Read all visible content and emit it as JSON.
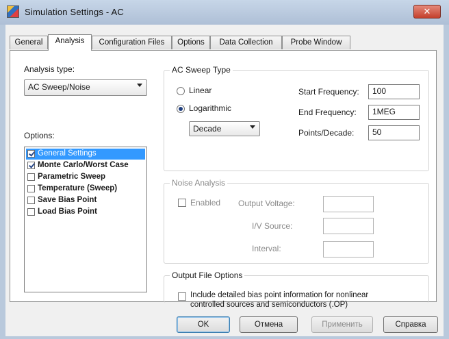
{
  "window": {
    "title": "Simulation Settings - AC",
    "close_glyph": "✕"
  },
  "tabs": [
    {
      "label": "General",
      "active": false
    },
    {
      "label": "Analysis",
      "active": true
    },
    {
      "label": "Configuration Files",
      "active": false
    },
    {
      "label": "Options",
      "active": false
    },
    {
      "label": "Data Collection",
      "active": false
    },
    {
      "label": "Probe Window",
      "active": false
    }
  ],
  "analysis": {
    "type_label": "Analysis type:",
    "type_value": "AC Sweep/Noise",
    "options_label": "Options:",
    "options": [
      {
        "label": "General Settings",
        "checked": true,
        "selected": true
      },
      {
        "label": "Monte Carlo/Worst Case",
        "checked": true,
        "selected": false
      },
      {
        "label": "Parametric Sweep",
        "checked": false,
        "selected": false
      },
      {
        "label": "Temperature (Sweep)",
        "checked": false,
        "selected": false
      },
      {
        "label": "Save Bias Point",
        "checked": false,
        "selected": false
      },
      {
        "label": "Load Bias Point",
        "checked": false,
        "selected": false
      }
    ]
  },
  "ac_sweep": {
    "title": "AC Sweep Type",
    "linear_label": "Linear",
    "log_label": "Logarithmic",
    "selected": "Logarithmic",
    "log_mode": "Decade",
    "start_freq_label": "Start Frequency:",
    "start_freq_value": "100",
    "end_freq_label": "End Frequency:",
    "end_freq_value": "1MEG",
    "points_label": "Points/Decade:",
    "points_value": "50"
  },
  "noise": {
    "title": "Noise Analysis",
    "enabled_label": "Enabled",
    "enabled": false,
    "output_voltage_label": "Output Voltage:",
    "output_voltage_value": "",
    "iv_source_label": "I/V Source:",
    "iv_source_value": "",
    "interval_label": "Interval:",
    "interval_value": ""
  },
  "output_file": {
    "title": "Output File Options",
    "detail_label_line1": "Include detailed bias point information for nonlinear",
    "detail_label_line2": "controlled sources and semiconductors (.OP)",
    "checked": false
  },
  "buttons": {
    "ok": "OK",
    "cancel": "Отмена",
    "apply": "Применить",
    "help": "Справка"
  }
}
